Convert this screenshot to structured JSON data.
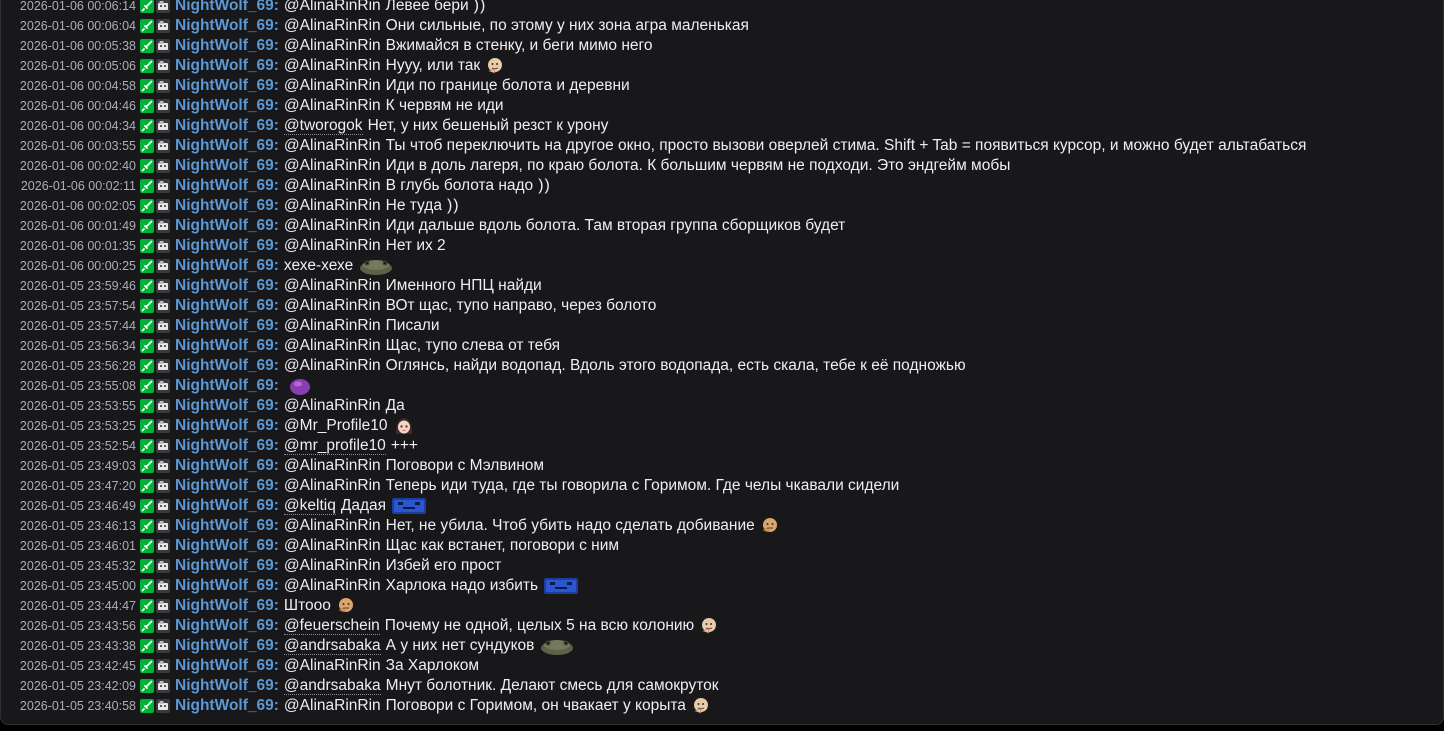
{
  "colors": {
    "background": "#18181b",
    "username": "#5b99d6",
    "timestamp": "#adadb8",
    "text": "#efeff1",
    "vip_badge": "#00b336"
  },
  "badges": [
    "sword-badge-icon",
    "moderator-badge-icon"
  ],
  "username": "NightWolf_69",
  "messages": [
    {
      "ts": "2026-01-06 00:06:14",
      "mention": "@AlinaRinRin",
      "text": "Левее бери",
      "emote": "smile-emote",
      "emote_glyph": "))"
    },
    {
      "ts": "2026-01-06 00:06:04",
      "mention": "@AlinaRinRin",
      "text": "Они сильные, по этому у них зона агра маленькая"
    },
    {
      "ts": "2026-01-06 00:05:38",
      "mention": "@AlinaRinRin",
      "text": "Вжимайся в стенку, и беги мимо него"
    },
    {
      "ts": "2026-01-06 00:05:06",
      "mention": "@AlinaRinRin",
      "text": "Нууу, или так",
      "emote": "thinking-face-emote"
    },
    {
      "ts": "2026-01-06 00:04:58",
      "mention": "@AlinaRinRin",
      "text": "Иди по границе болота и деревни"
    },
    {
      "ts": "2026-01-06 00:04:46",
      "mention": "@AlinaRinRin",
      "text": "К червям не иди"
    },
    {
      "ts": "2026-01-06 00:04:34",
      "mention": "@tworogok",
      "underlined": true,
      "text": "Нет, у них бешеный резст к урону"
    },
    {
      "ts": "2026-01-06 00:03:55",
      "mention": "@AlinaRinRin",
      "text": "Ты чтоб переключить на другое окно, просто вызови оверлей стима. Shift + Tab = появиться курсор, и можно будет альтабаться"
    },
    {
      "ts": "2026-01-06 00:02:40",
      "mention": "@AlinaRinRin",
      "text": "Иди в доль лагеря, по краю болота. К большим червям не подходи. Это эндгейм мобы"
    },
    {
      "ts": "2026-01-06 00:02:11",
      "mention": "@AlinaRinRin",
      "text": "В глубь болота надо",
      "emote": "smile-emote",
      "emote_glyph": "))"
    },
    {
      "ts": "2026-01-06 00:02:05",
      "mention": "@AlinaRinRin",
      "text": "Не туда",
      "emote": "smile-emote",
      "emote_glyph": "))"
    },
    {
      "ts": "2026-01-06 00:01:49",
      "mention": "@AlinaRinRin",
      "text": "Иди дальше вдоль болота. Там вторая группа сборщиков будет"
    },
    {
      "ts": "2026-01-06 00:01:35",
      "mention": "@AlinaRinRin",
      "text": "Нет их 2"
    },
    {
      "ts": "2026-01-06 00:00:25",
      "mention": "",
      "text": "хехе-хехе",
      "emote": "toad-emote"
    },
    {
      "ts": "2026-01-05 23:59:46",
      "mention": "@AlinaRinRin",
      "text": "Именного НПЦ найди"
    },
    {
      "ts": "2026-01-05 23:57:54",
      "mention": "@AlinaRinRin",
      "text": "ВОт щас, тупо направо, через болото"
    },
    {
      "ts": "2026-01-05 23:57:44",
      "mention": "@AlinaRinRin",
      "text": "Писали"
    },
    {
      "ts": "2026-01-05 23:56:34",
      "mention": "@AlinaRinRin",
      "text": "Щас, тупо слева от тебя"
    },
    {
      "ts": "2026-01-05 23:56:28",
      "mention": "@AlinaRinRin",
      "text": "Оглянсь, найди водопад. Вдоль этого водопада, есть скала, тебе к её подножью"
    },
    {
      "ts": "2026-01-05 23:55:08",
      "mention": "",
      "text": "",
      "emote": "purple-blob-emote"
    },
    {
      "ts": "2026-01-05 23:53:55",
      "mention": "@AlinaRinRin",
      "text": "Да"
    },
    {
      "ts": "2026-01-05 23:53:25",
      "mention": "@Mr_Profile10",
      "text": "",
      "emote": "anime-girl-emote"
    },
    {
      "ts": "2026-01-05 23:52:54",
      "mention": "@mr_profile10",
      "underlined": true,
      "text": "+++"
    },
    {
      "ts": "2026-01-05 23:49:03",
      "mention": "@AlinaRinRin",
      "text": "Поговори с Мэлвином"
    },
    {
      "ts": "2026-01-05 23:47:20",
      "mention": "@AlinaRinRin",
      "text": "Теперь иди туда, где ты говорила с Горимом. Где челы чкавали сидели"
    },
    {
      "ts": "2026-01-05 23:46:49",
      "mention": "@keltiq",
      "underlined": true,
      "text": "Дадая",
      "emote": "blue-banner-emote"
    },
    {
      "ts": "2026-01-05 23:46:13",
      "mention": "@AlinaRinRin",
      "text": "Нет, не убила. Чтоб убить надо сделать добивание",
      "emote": "pointing-face-emote"
    },
    {
      "ts": "2026-01-05 23:46:01",
      "mention": "@AlinaRinRin",
      "text": "Щас как встанет, поговори с ним"
    },
    {
      "ts": "2026-01-05 23:45:32",
      "mention": "@AlinaRinRin",
      "text": "Избей его прост"
    },
    {
      "ts": "2026-01-05 23:45:00",
      "mention": "@AlinaRinRin",
      "text": "Харлока надо избить",
      "emote": "blue-banner-emote"
    },
    {
      "ts": "2026-01-05 23:44:47",
      "mention": "",
      "text": "Штооо",
      "emote": "pointing-face-emote"
    },
    {
      "ts": "2026-01-05 23:43:56",
      "mention": "@feuerschein",
      "underlined": true,
      "text": "Почему не одной, целых 5 на всю колонию",
      "emote": "thinking-face-emote"
    },
    {
      "ts": "2026-01-05 23:43:38",
      "mention": "@andrsabaka",
      "underlined": true,
      "text": "А у них нет сундуков",
      "emote": "toad-emote"
    },
    {
      "ts": "2026-01-05 23:42:45",
      "mention": "@AlinaRinRin",
      "text": "За Харлоком"
    },
    {
      "ts": "2026-01-05 23:42:09",
      "mention": "@andrsabaka",
      "underlined": true,
      "text": "Мнут болотник. Делают смесь для самокруток"
    },
    {
      "ts": "2026-01-05 23:40:58",
      "mention": "@AlinaRinRin",
      "text": "Поговори с Горимом, он чвакает у корыта",
      "emote": "thinking-face-emote"
    }
  ]
}
